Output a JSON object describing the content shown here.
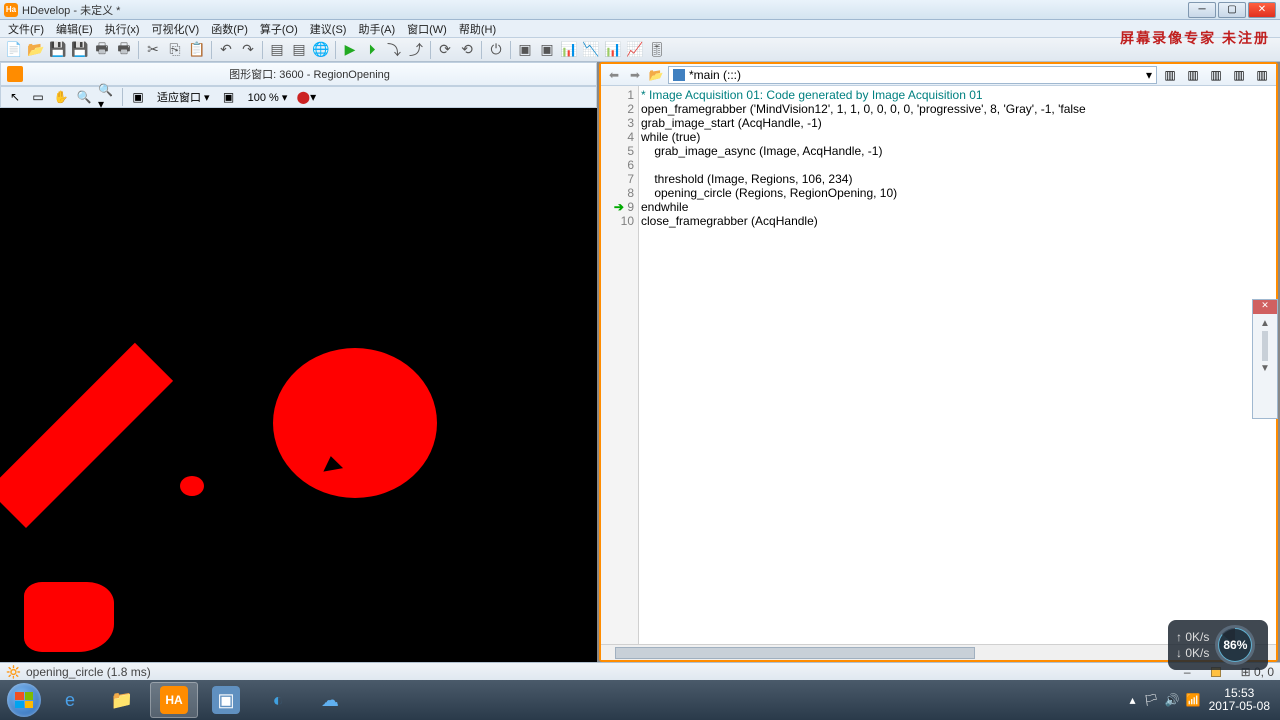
{
  "titlebar": {
    "title": "HDevelop - 未定义 *"
  },
  "menubar": {
    "items": [
      "文件(F)",
      "编辑(E)",
      "执行(x)",
      "可视化(V)",
      "函数(P)",
      "算子(O)",
      "建议(S)",
      "助手(A)",
      "窗口(W)",
      "帮助(H)"
    ]
  },
  "watermark": "屏幕录像专家 未注册",
  "gfx_window": {
    "title": "图形窗口: 3600 - RegionOpening",
    "fit_label": "适应窗口 ▾",
    "zoom": "100 %  ▾"
  },
  "code_toolbar": {
    "file": "*main (:::)"
  },
  "code": {
    "lines": [
      {
        "n": "1",
        "text": "* Image Acquisition 01: Code generated by Image Acquisition 01",
        "cls": "comment"
      },
      {
        "n": "2",
        "text": "open_framegrabber ('MindVision12', 1, 1, 0, 0, 0, 0, 'progressive', 8, 'Gray', -1, 'false"
      },
      {
        "n": "3",
        "text": "grab_image_start (AcqHandle, -1)"
      },
      {
        "n": "4",
        "text": "while (true)"
      },
      {
        "n": "5",
        "text": "    grab_image_async (Image, AcqHandle, -1)"
      },
      {
        "n": "6",
        "text": "    "
      },
      {
        "n": "7",
        "text": "    threshold (Image, Regions, 106, 234)"
      },
      {
        "n": "8",
        "text": "    opening_circle (Regions, RegionOpening, 10)"
      },
      {
        "n": "9",
        "text": "endwhile",
        "arrow": true
      },
      {
        "n": "10",
        "text": "close_framegrabber (AcqHandle)"
      }
    ]
  },
  "statusbar": {
    "left": "opening_circle (1.8 ms)",
    "dash": "–",
    "coords": "0, 0"
  },
  "tray": {
    "time": "15:53",
    "date": "2017-05-08",
    "net_up": "0K/s",
    "net_dn": "0K/s",
    "battery": "86%"
  }
}
